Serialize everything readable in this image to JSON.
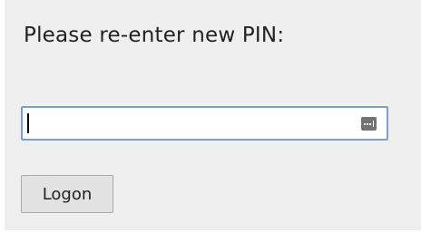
{
  "form": {
    "prompt_label": "Please re-enter new PIN:",
    "pin_value": "",
    "pin_placeholder": "",
    "logon_label": "Logon"
  },
  "icons": {
    "password_manager": "password-key-icon"
  },
  "colors": {
    "panel_background": "#efefef",
    "field_border_focused": "#7b9fd1",
    "button_background": "#e2e2e2"
  }
}
